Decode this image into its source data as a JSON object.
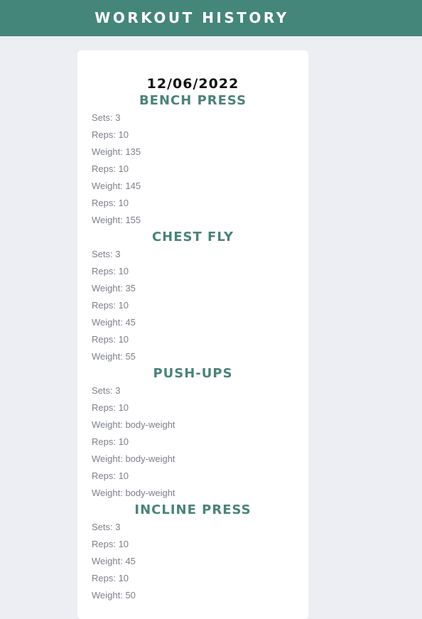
{
  "header": {
    "title": "WORKOUT HISTORY"
  },
  "workout": {
    "date": "12/06/2022",
    "exercises": [
      {
        "name": "BENCH PRESS",
        "rows": [
          "Sets: 3",
          "Reps: 10",
          "Weight: 135",
          "Reps: 10",
          "Weight: 145",
          "Reps: 10",
          "Weight: 155"
        ]
      },
      {
        "name": "CHEST FLY",
        "rows": [
          "Sets: 3",
          "Reps: 10",
          "Weight: 35",
          "Reps: 10",
          "Weight: 45",
          "Reps: 10",
          "Weight: 55"
        ]
      },
      {
        "name": "PUSH-UPS",
        "rows": [
          "Sets: 3",
          "Reps: 10",
          "Weight: body-weight",
          "Reps: 10",
          "Weight: body-weight",
          "Reps: 10",
          "Weight: body-weight"
        ]
      },
      {
        "name": "INCLINE PRESS",
        "rows": [
          "Sets: 3",
          "Reps: 10",
          "Weight: 45",
          "Reps: 10",
          "Weight: 50"
        ]
      }
    ]
  },
  "colors": {
    "header_bg": "#45867a",
    "accent": "#4a837a",
    "page_bg": "#eceef4",
    "row_text": "#7c8089"
  }
}
